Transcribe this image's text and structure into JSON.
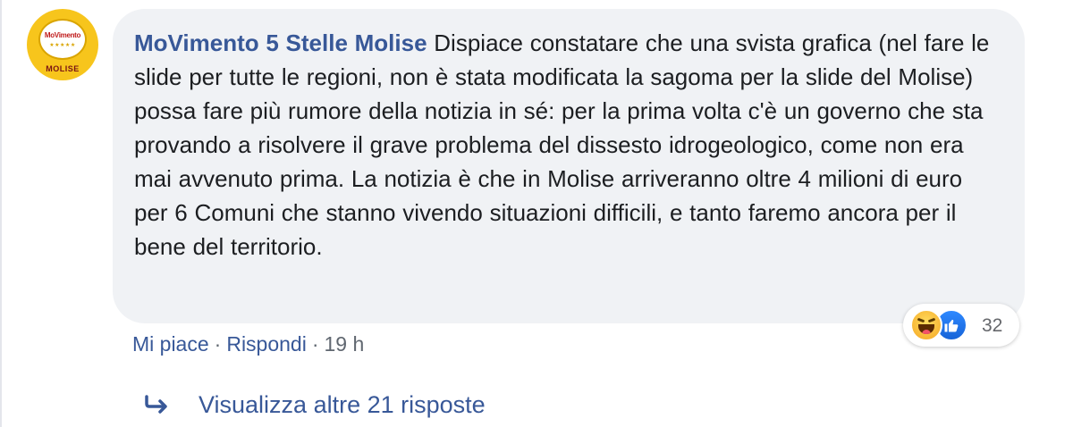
{
  "comment": {
    "author": "MoVimento 5 Stelle Molise",
    "text": "Dispiace constatare che una svista grafica (nel fare le slide per tutte le regioni, non è stata modificata la sagoma per la slide del Molise) possa fare più rumore della notizia in sé: per la prima volta c'è un governo che sta provando a risolvere il grave problema del dissesto idrogeologico, come non era mai avvenuto prima. La notizia è che in Molise arriveranno oltre 4 milioni di euro per 6 Comuni che stanno vivendo situazioni difficili, e tanto faremo ancora per il bene del territorio.",
    "avatar": {
      "logo_text": "MoVimento",
      "stars": "★★★★★",
      "region": "MOLISE",
      "background": "#f7c51c"
    }
  },
  "reactions": {
    "icons": [
      "haha-icon",
      "like-icon"
    ],
    "count": "32"
  },
  "actions": {
    "like": "Mi piace",
    "separator": "·",
    "reply": "Rispondi",
    "time": "19 h"
  },
  "replies": {
    "label": "Visualizza altre 21 risposte",
    "icon": "reply-arrow-icon"
  },
  "colors": {
    "link": "#385898",
    "bubble": "#f0f2f5",
    "text": "#1c1e21",
    "muted": "#606770",
    "like_blue": "#1877f2"
  }
}
